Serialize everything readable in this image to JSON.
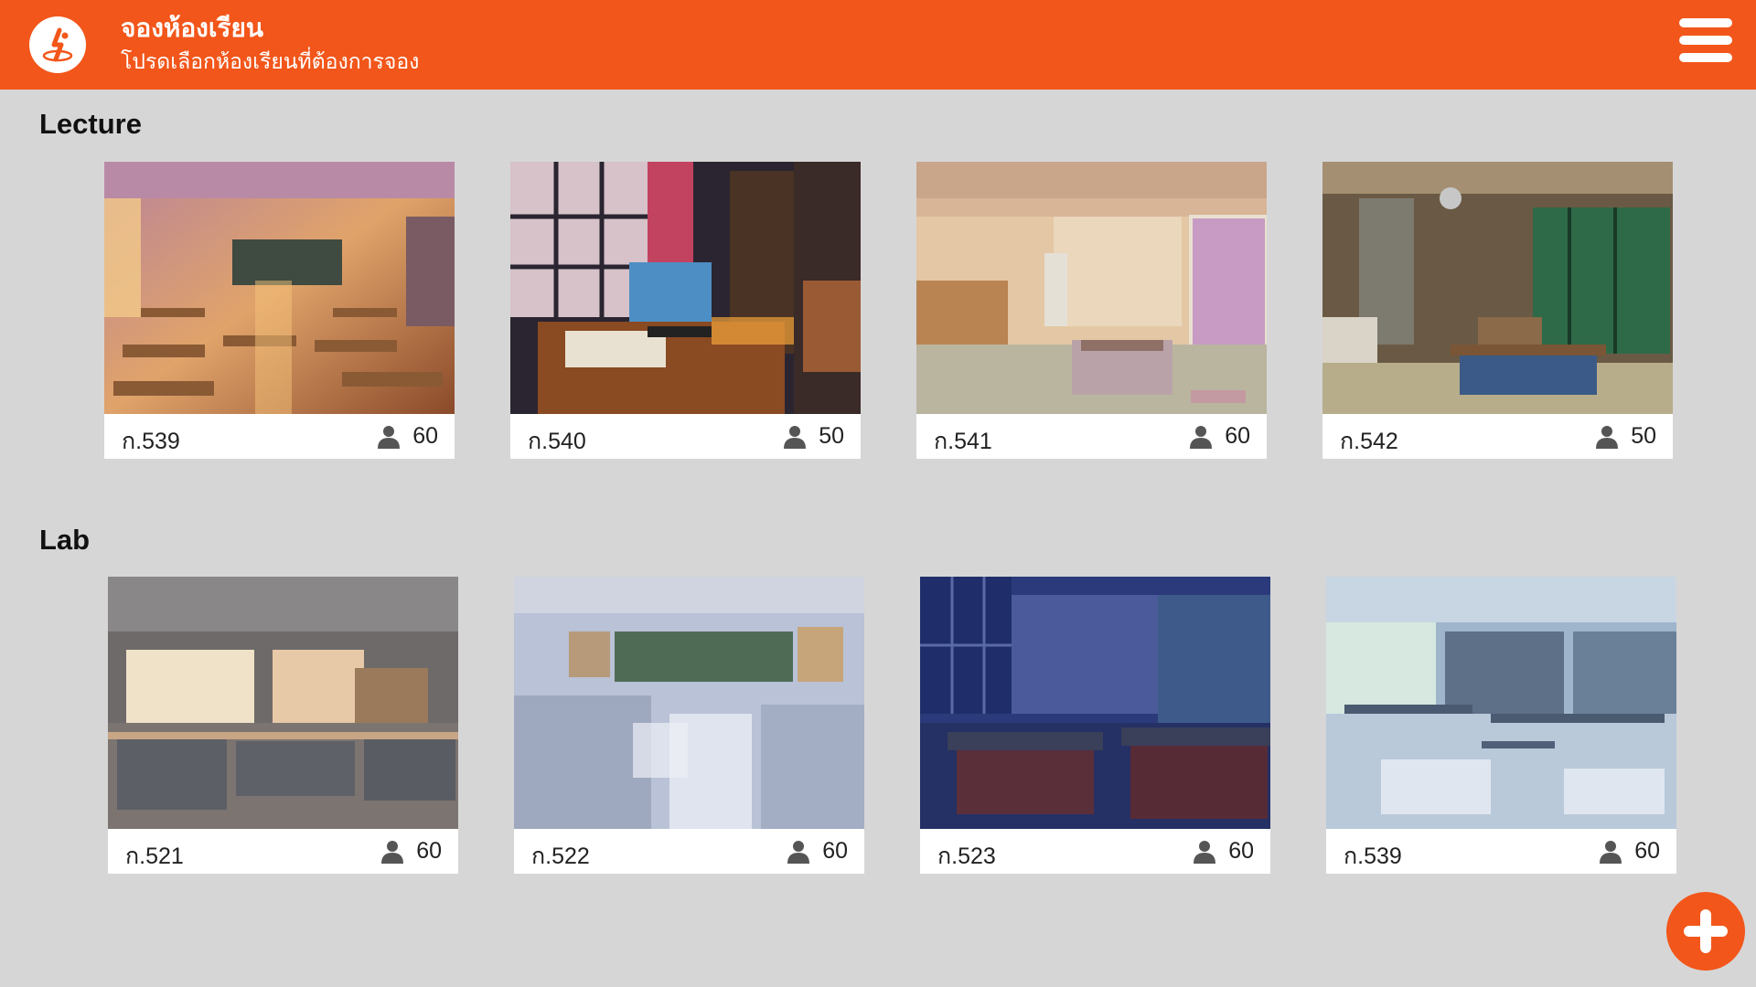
{
  "header": {
    "title": "จองห้องเรียน",
    "subtitle": "โปรดเลือกห้องเรียนที่ต้องการจอง",
    "logo_icon": "runner-logo-icon",
    "menu_icon": "hamburger-menu-icon",
    "color": "#f2561a"
  },
  "sections": [
    {
      "title": "Lecture",
      "rooms": [
        {
          "name": "ก.539",
          "capacity": "60",
          "scene": "classroom-sunset"
        },
        {
          "name": "ก.540",
          "capacity": "50",
          "scene": "study-desk-night"
        },
        {
          "name": "ก.541",
          "capacity": "60",
          "scene": "japanese-room"
        },
        {
          "name": "ก.542",
          "capacity": "50",
          "scene": "japanese-room-rain"
        }
      ]
    },
    {
      "title": "Lab",
      "rooms": [
        {
          "name": "ก.521",
          "capacity": "60",
          "scene": "science-lab-day"
        },
        {
          "name": "ก.522",
          "capacity": "60",
          "scene": "science-lab-bright"
        },
        {
          "name": "ก.523",
          "capacity": "60",
          "scene": "science-lab-night"
        },
        {
          "name": "ก.539",
          "capacity": "60",
          "scene": "lab-blue"
        }
      ]
    }
  ],
  "fab": {
    "icon": "plus-icon"
  }
}
